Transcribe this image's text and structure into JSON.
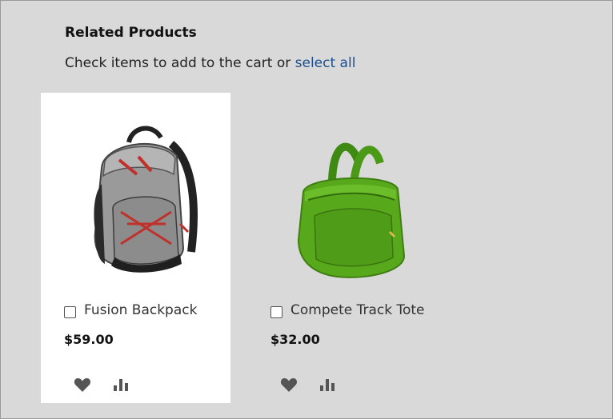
{
  "section": {
    "title": "Related Products",
    "instructions_prefix": "Check items to add to the cart or ",
    "select_all_label": "select all"
  },
  "products": [
    {
      "name": "Fusion Backpack",
      "price": "$59.00",
      "checked": false,
      "image_icon": "backpack-image",
      "wishlist_icon": "heart-icon",
      "compare_icon": "bar-chart-icon"
    },
    {
      "name": "Compete Track Tote",
      "price": "$32.00",
      "checked": false,
      "image_icon": "tote-bag-image",
      "wishlist_icon": "heart-icon",
      "compare_icon": "bar-chart-icon"
    }
  ],
  "colors": {
    "background": "#d9d9d9",
    "card_background": "#ffffff",
    "link": "#1c4f8e",
    "icon": "#555555",
    "tote_green": "#58a81c"
  }
}
